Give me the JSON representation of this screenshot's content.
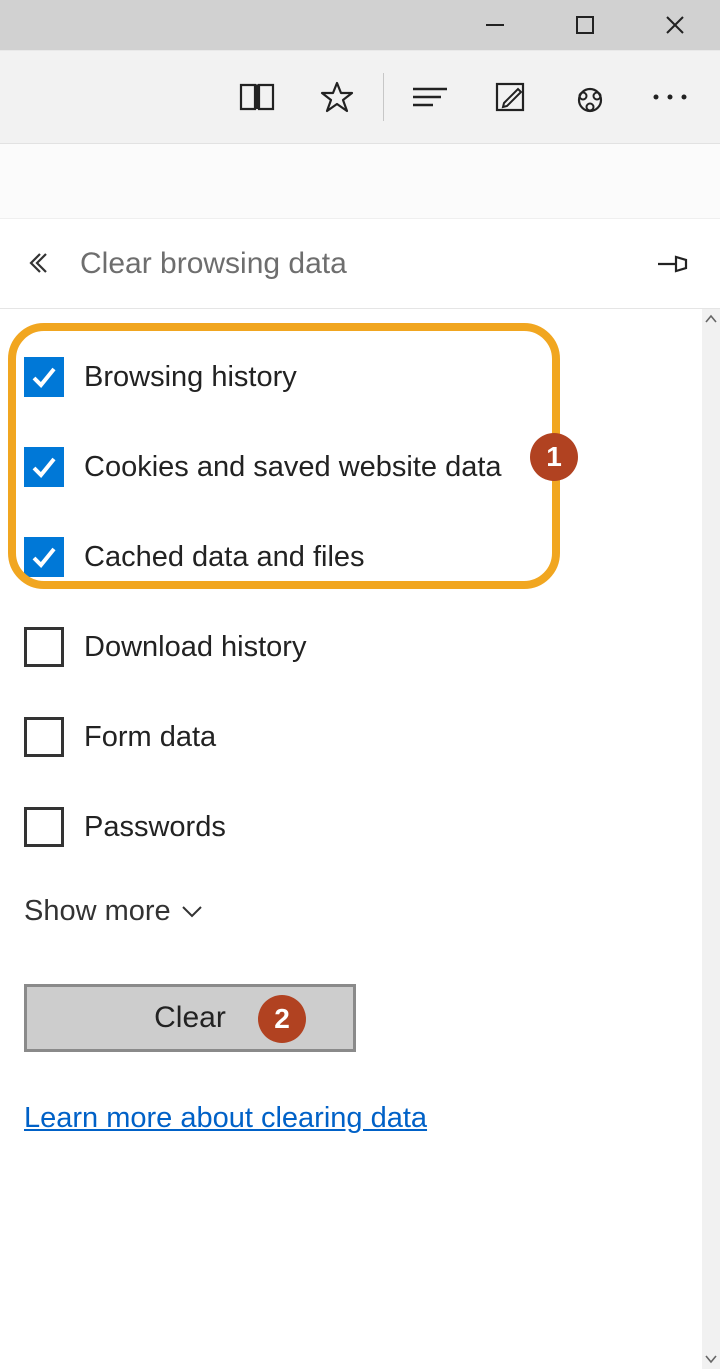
{
  "panel": {
    "title": "Clear browsing data",
    "items": [
      {
        "label": "Browsing history",
        "checked": true
      },
      {
        "label": "Cookies and saved website data",
        "checked": true
      },
      {
        "label": "Cached data and files",
        "checked": true
      },
      {
        "label": "Download history",
        "checked": false
      },
      {
        "label": "Form data",
        "checked": false
      },
      {
        "label": "Passwords",
        "checked": false
      }
    ],
    "show_more": "Show more",
    "clear_button": "Clear",
    "learn_link": "Learn more about clearing data"
  },
  "callouts": {
    "badge1": "1",
    "badge2": "2"
  }
}
